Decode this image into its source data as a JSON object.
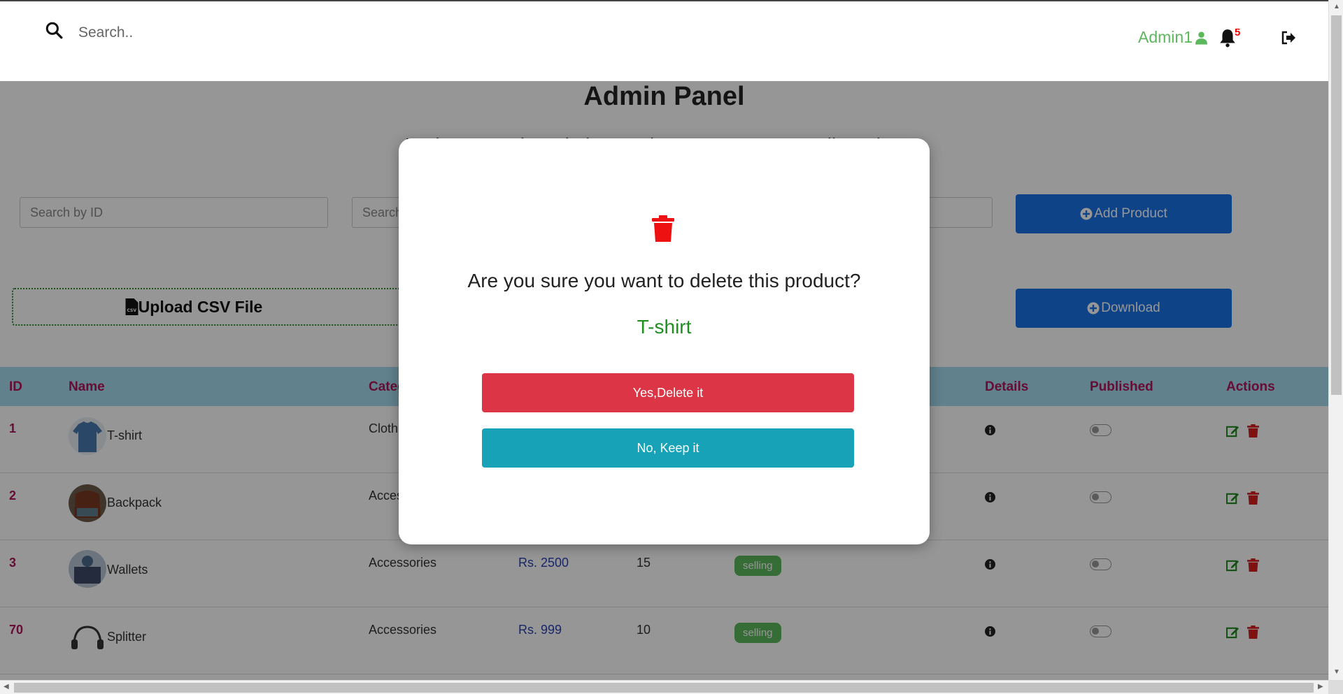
{
  "header": {
    "search_placeholder": "Search..",
    "admin_label": "Admin1",
    "notification_count": "5"
  },
  "page": {
    "title": "Admin Panel",
    "welcome_text": "Welcome to the admin panel. You can manage all products."
  },
  "filters": {
    "search_id_placeholder": "Search by ID",
    "search_name_placeholder": "Search",
    "add_product_label": "Add Product",
    "upload_csv_label": "Upload CSV File",
    "download_label": "Download"
  },
  "table": {
    "headers": {
      "id": "ID",
      "name": "Name",
      "category": "Category",
      "details": "Details",
      "published": "Published",
      "actions": "Actions"
    },
    "rows": [
      {
        "id": "1",
        "name": "T-shirt",
        "category": "Clothing",
        "price": "",
        "stock": "",
        "status": "",
        "published": false
      },
      {
        "id": "2",
        "name": "Backpack",
        "category": "Accessories",
        "price": "",
        "stock": "",
        "status": "",
        "published": false
      },
      {
        "id": "3",
        "name": "Wallets",
        "category": "Accessories",
        "price": "Rs. 2500",
        "stock": "15",
        "status": "selling",
        "published": false
      },
      {
        "id": "70",
        "name": "Splitter",
        "category": "Accessories",
        "price": "Rs. 999",
        "stock": "10",
        "status": "selling",
        "published": false
      }
    ]
  },
  "modal": {
    "question": "Are you sure you want to delete this product?",
    "product_name": "T-shirt",
    "confirm_label": "Yes,Delete it",
    "cancel_label": "No, Keep it"
  },
  "colors": {
    "accent_blue": "#1a73e8",
    "danger": "#dc3545",
    "info": "#17a2b8",
    "success": "#5cb85c",
    "table_header": "#a6dcef",
    "header_text": "#b0175a"
  }
}
